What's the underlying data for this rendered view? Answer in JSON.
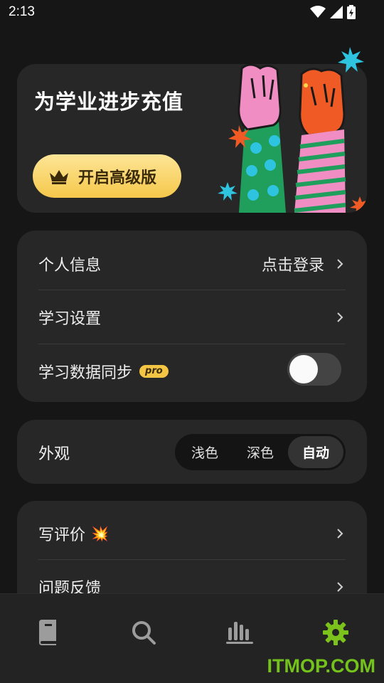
{
  "status_bar": {
    "time": "2:13"
  },
  "promo": {
    "title": "为学业进步充值",
    "button_label": "开启高级版"
  },
  "account_card": {
    "profile_label": "个人信息",
    "profile_value": "点击登录",
    "study_settings_label": "学习设置",
    "sync_label": "学习数据同步",
    "sync_badge": "pro",
    "sync_enabled": false
  },
  "appearance_card": {
    "label": "外观",
    "options": [
      "浅色",
      "深色",
      "自动"
    ],
    "selected": "自动"
  },
  "feedback_card": {
    "review_label": "写评价",
    "review_emoji": "💥",
    "feedback_label": "问题反馈"
  },
  "bottom_nav": {
    "items": [
      "book-icon",
      "search-icon",
      "stats-icon",
      "settings-icon"
    ],
    "active": "settings-icon",
    "active_color": "#7cc21c"
  },
  "watermark": "ITMOP.COM"
}
